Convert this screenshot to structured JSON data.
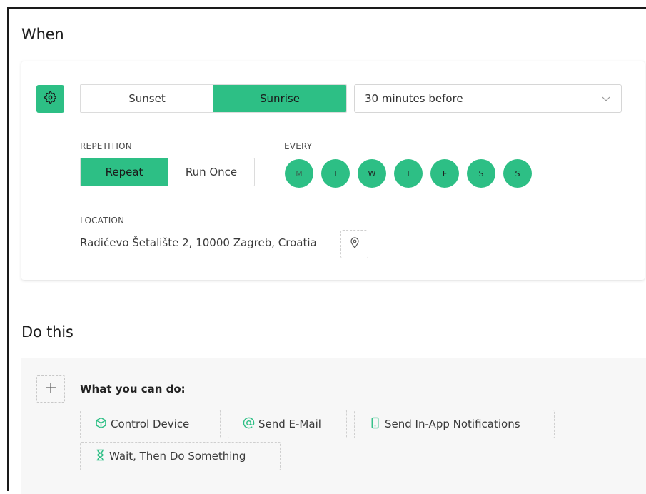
{
  "when": {
    "title": "When",
    "sun_options": [
      "Sunset",
      "Sunrise"
    ],
    "sun_selected": "Sunrise",
    "offset": {
      "value": "30 minutes before"
    },
    "repetition": {
      "label": "REPETITION",
      "options": [
        "Repeat",
        "Run Once"
      ],
      "selected": "Repeat"
    },
    "every": {
      "label": "EVERY",
      "days": [
        "M",
        "T",
        "W",
        "T",
        "F",
        "S",
        "S"
      ]
    },
    "location": {
      "label": "LOCATION",
      "address": "Radićevo Šetalište 2, 10000 Zagreb, Croatia"
    }
  },
  "do_this": {
    "title": "Do this",
    "heading": "What you can do:",
    "actions": [
      {
        "label": "Control Device",
        "icon": "cube-icon"
      },
      {
        "label": "Send E-Mail",
        "icon": "at-icon"
      },
      {
        "label": "Send In-App Notifications",
        "icon": "phone-icon"
      },
      {
        "label": "Wait, Then Do Something",
        "icon": "hourglass-icon"
      }
    ]
  },
  "colors": {
    "accent": "#2dbf85",
    "panel_bg": "#f7f7f7"
  }
}
